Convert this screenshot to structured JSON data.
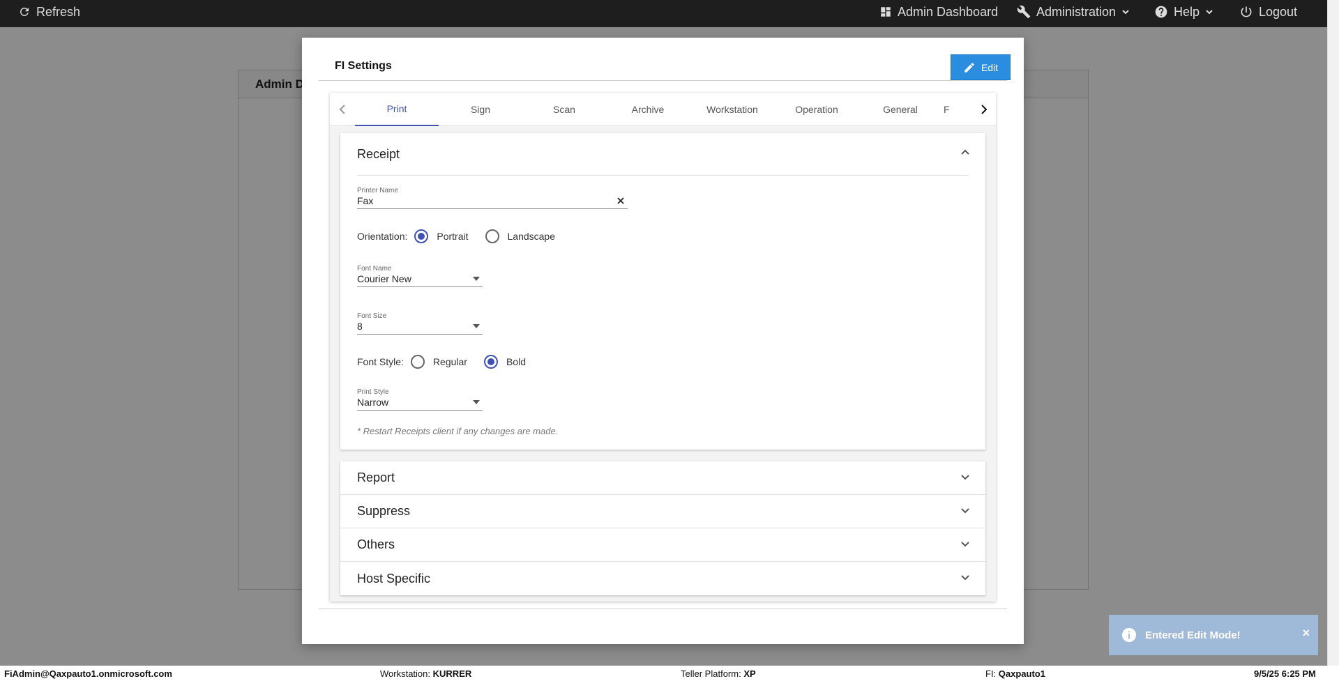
{
  "topbar": {
    "refresh": "Refresh",
    "admin_dashboard": "Admin Dashboard",
    "administration": "Administration",
    "help": "Help",
    "logout": "Logout"
  },
  "background": {
    "card_title": "Admin D"
  },
  "modal": {
    "title": "FI Settings",
    "edit_label": "Edit",
    "tabs": [
      {
        "label": "Print",
        "active": true
      },
      {
        "label": "Sign"
      },
      {
        "label": "Scan"
      },
      {
        "label": "Archive"
      },
      {
        "label": "Workstation"
      },
      {
        "label": "Operation"
      },
      {
        "label": "General"
      },
      {
        "label": "F"
      }
    ],
    "receipt": {
      "title": "Receipt",
      "printer_name_label": "Printer Name",
      "printer_name_value": "Fax",
      "orientation_label": "Orientation:",
      "orientation_options": [
        "Portrait",
        "Landscape"
      ],
      "orientation_selected": "Portrait",
      "font_name_label": "Font Name",
      "font_name_value": "Courier New",
      "font_size_label": "Font Size",
      "font_size_value": "8",
      "font_style_label": "Font Style:",
      "font_style_options": [
        "Regular",
        "Bold"
      ],
      "font_style_selected": "Bold",
      "print_style_label": "Print Style",
      "print_style_value": "Narrow",
      "note": "* Restart Receipts client if any changes are made."
    },
    "sections": [
      "Report",
      "Suppress",
      "Others",
      "Host Specific"
    ]
  },
  "toast": {
    "message": "Entered Edit Mode!",
    "close": "×"
  },
  "status": {
    "user": "FiAdmin@Qaxpauto1.onmicrosoft.com",
    "workstation_label": "Workstation:",
    "workstation_value": "KURRER",
    "platform_label": "Teller Platform:",
    "platform_value": "XP",
    "fi_label": "FI:",
    "fi_value": "Qaxpauto1",
    "datetime": "9/5/25 6:25 PM"
  },
  "colors": {
    "accent": "#3f51b5",
    "edit_button": "#2b8de0",
    "topbar": "#1e1e1e",
    "toast": "#9fb9d8"
  }
}
